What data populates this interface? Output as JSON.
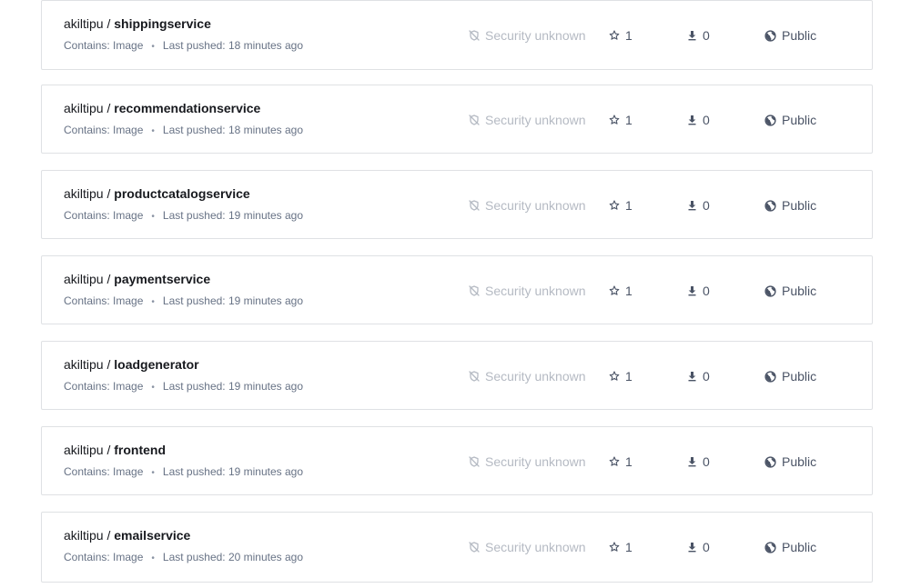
{
  "repositories": [
    {
      "namespace": "akiltipu",
      "separator": "/",
      "name": "shippingservice",
      "contains": "Contains: Image",
      "last_pushed": "Last pushed: 18 minutes ago",
      "security": "Security unknown",
      "stars": "1",
      "pulls": "0",
      "visibility": "Public"
    },
    {
      "namespace": "akiltipu",
      "separator": "/",
      "name": "recommendationservice",
      "contains": "Contains: Image",
      "last_pushed": "Last pushed: 18 minutes ago",
      "security": "Security unknown",
      "stars": "1",
      "pulls": "0",
      "visibility": "Public"
    },
    {
      "namespace": "akiltipu",
      "separator": "/",
      "name": "productcatalogservice",
      "contains": "Contains: Image",
      "last_pushed": "Last pushed: 19 minutes ago",
      "security": "Security unknown",
      "stars": "1",
      "pulls": "0",
      "visibility": "Public"
    },
    {
      "namespace": "akiltipu",
      "separator": "/",
      "name": "paymentservice",
      "contains": "Contains: Image",
      "last_pushed": "Last pushed: 19 minutes ago",
      "security": "Security unknown",
      "stars": "1",
      "pulls": "0",
      "visibility": "Public"
    },
    {
      "namespace": "akiltipu",
      "separator": "/",
      "name": "loadgenerator",
      "contains": "Contains: Image",
      "last_pushed": "Last pushed: 19 minutes ago",
      "security": "Security unknown",
      "stars": "1",
      "pulls": "0",
      "visibility": "Public"
    },
    {
      "namespace": "akiltipu",
      "separator": "/",
      "name": "frontend",
      "contains": "Contains: Image",
      "last_pushed": "Last pushed: 19 minutes ago",
      "security": "Security unknown",
      "stars": "1",
      "pulls": "0",
      "visibility": "Public"
    },
    {
      "namespace": "akiltipu",
      "separator": "/",
      "name": "emailservice",
      "contains": "Contains: Image",
      "last_pushed": "Last pushed: 20 minutes ago",
      "security": "Security unknown",
      "stars": "1",
      "pulls": "0",
      "visibility": "Public"
    }
  ],
  "meta_separator": "•",
  "icons": {
    "security": "shield-off-icon",
    "stars": "star-outline-icon",
    "pulls": "download-icon",
    "visibility": "globe-icon"
  },
  "colors": {
    "border": "#dfe1e4",
    "text_primary": "#17191e",
    "text_secondary": "#677285",
    "text_muted": "#b5bac3"
  }
}
